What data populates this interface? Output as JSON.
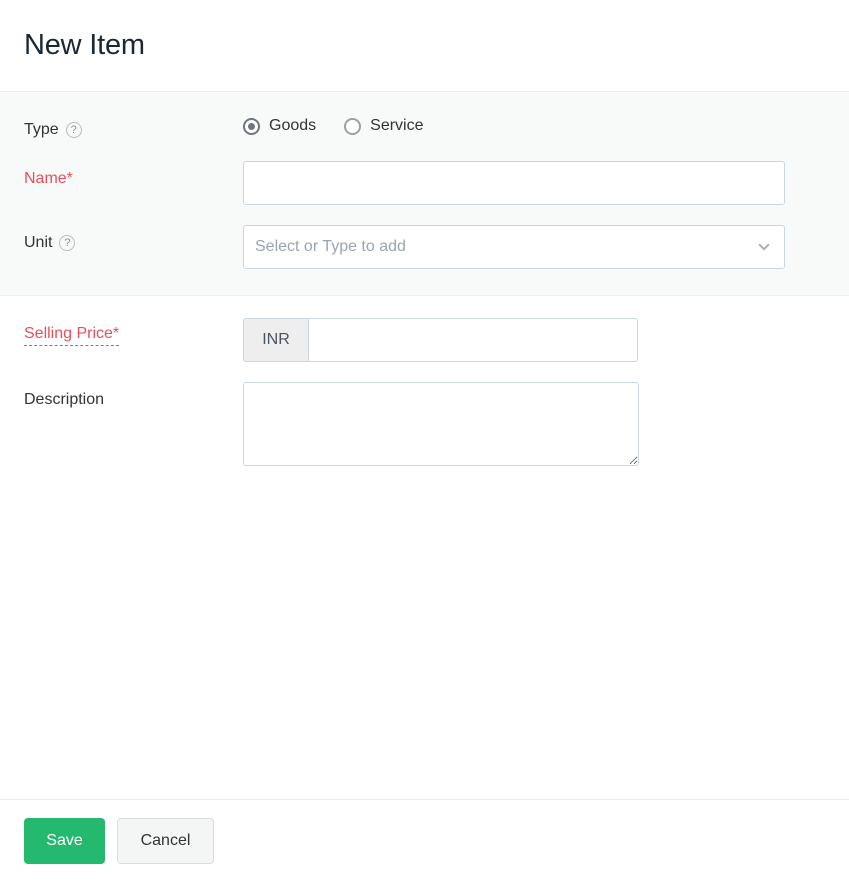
{
  "header": {
    "title": "New Item"
  },
  "form": {
    "sections": [
      {
        "name": "primary",
        "rows": [
          {
            "label": "Type",
            "help_icon": "question-circle-icon",
            "control": "radio-group"
          },
          {
            "label": "Name*",
            "required": true,
            "control": "text-input",
            "value": "",
            "placeholder": ""
          },
          {
            "label": "Unit",
            "help_icon": "question-circle-icon",
            "control": "select",
            "value": "",
            "placeholder": "Select or Type to add",
            "chevron_icon": "chevron-down-icon"
          }
        ]
      },
      {
        "name": "pricing",
        "rows": [
          {
            "label": "Selling Price*",
            "required": true,
            "dotted_underline": true,
            "control": "currency-input",
            "currency": "INR",
            "value": "",
            "placeholder": ""
          },
          {
            "label": "Description",
            "control": "textarea",
            "value": "",
            "placeholder": ""
          }
        ]
      }
    ],
    "type_options": [
      {
        "label": "Goods",
        "selected": true
      },
      {
        "label": "Service",
        "selected": false
      }
    ],
    "help_glyph": "?"
  },
  "footer": {
    "save_label": "Save",
    "cancel_label": "Cancel"
  },
  "colors": {
    "accent_green": "#25b96f",
    "required_red": "#e8505b",
    "title_dark": "#1b2733",
    "label_dark": "#333333",
    "border_input": "#ccd6dd",
    "section_shaded_bg": "#f8f9f9",
    "addon_bg": "#eeeeee",
    "placeholder": "#9aa5b1"
  }
}
